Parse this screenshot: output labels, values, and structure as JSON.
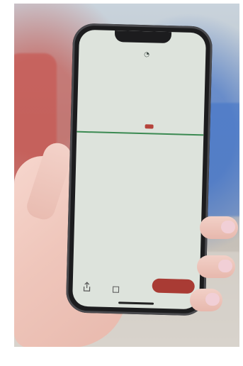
{
  "photo": {
    "description_colors": {
      "screen_bg": "#dde3dc",
      "accent_green": "#3b8a52",
      "accent_red": "#a93b34"
    }
  },
  "phone": {
    "status_bar": {
      "time": "",
      "battery": ""
    },
    "top_bar": {
      "icon_a": "◔",
      "icon_b": "",
      "icon_c": ""
    },
    "header": {
      "line1": "",
      "line2": ""
    },
    "title_mark": "",
    "subtitle": "",
    "columns": [
      "",
      "",
      "",
      "",
      "",
      ""
    ],
    "bottom_bar": {
      "mid_label": "",
      "primary_button": ""
    }
  }
}
